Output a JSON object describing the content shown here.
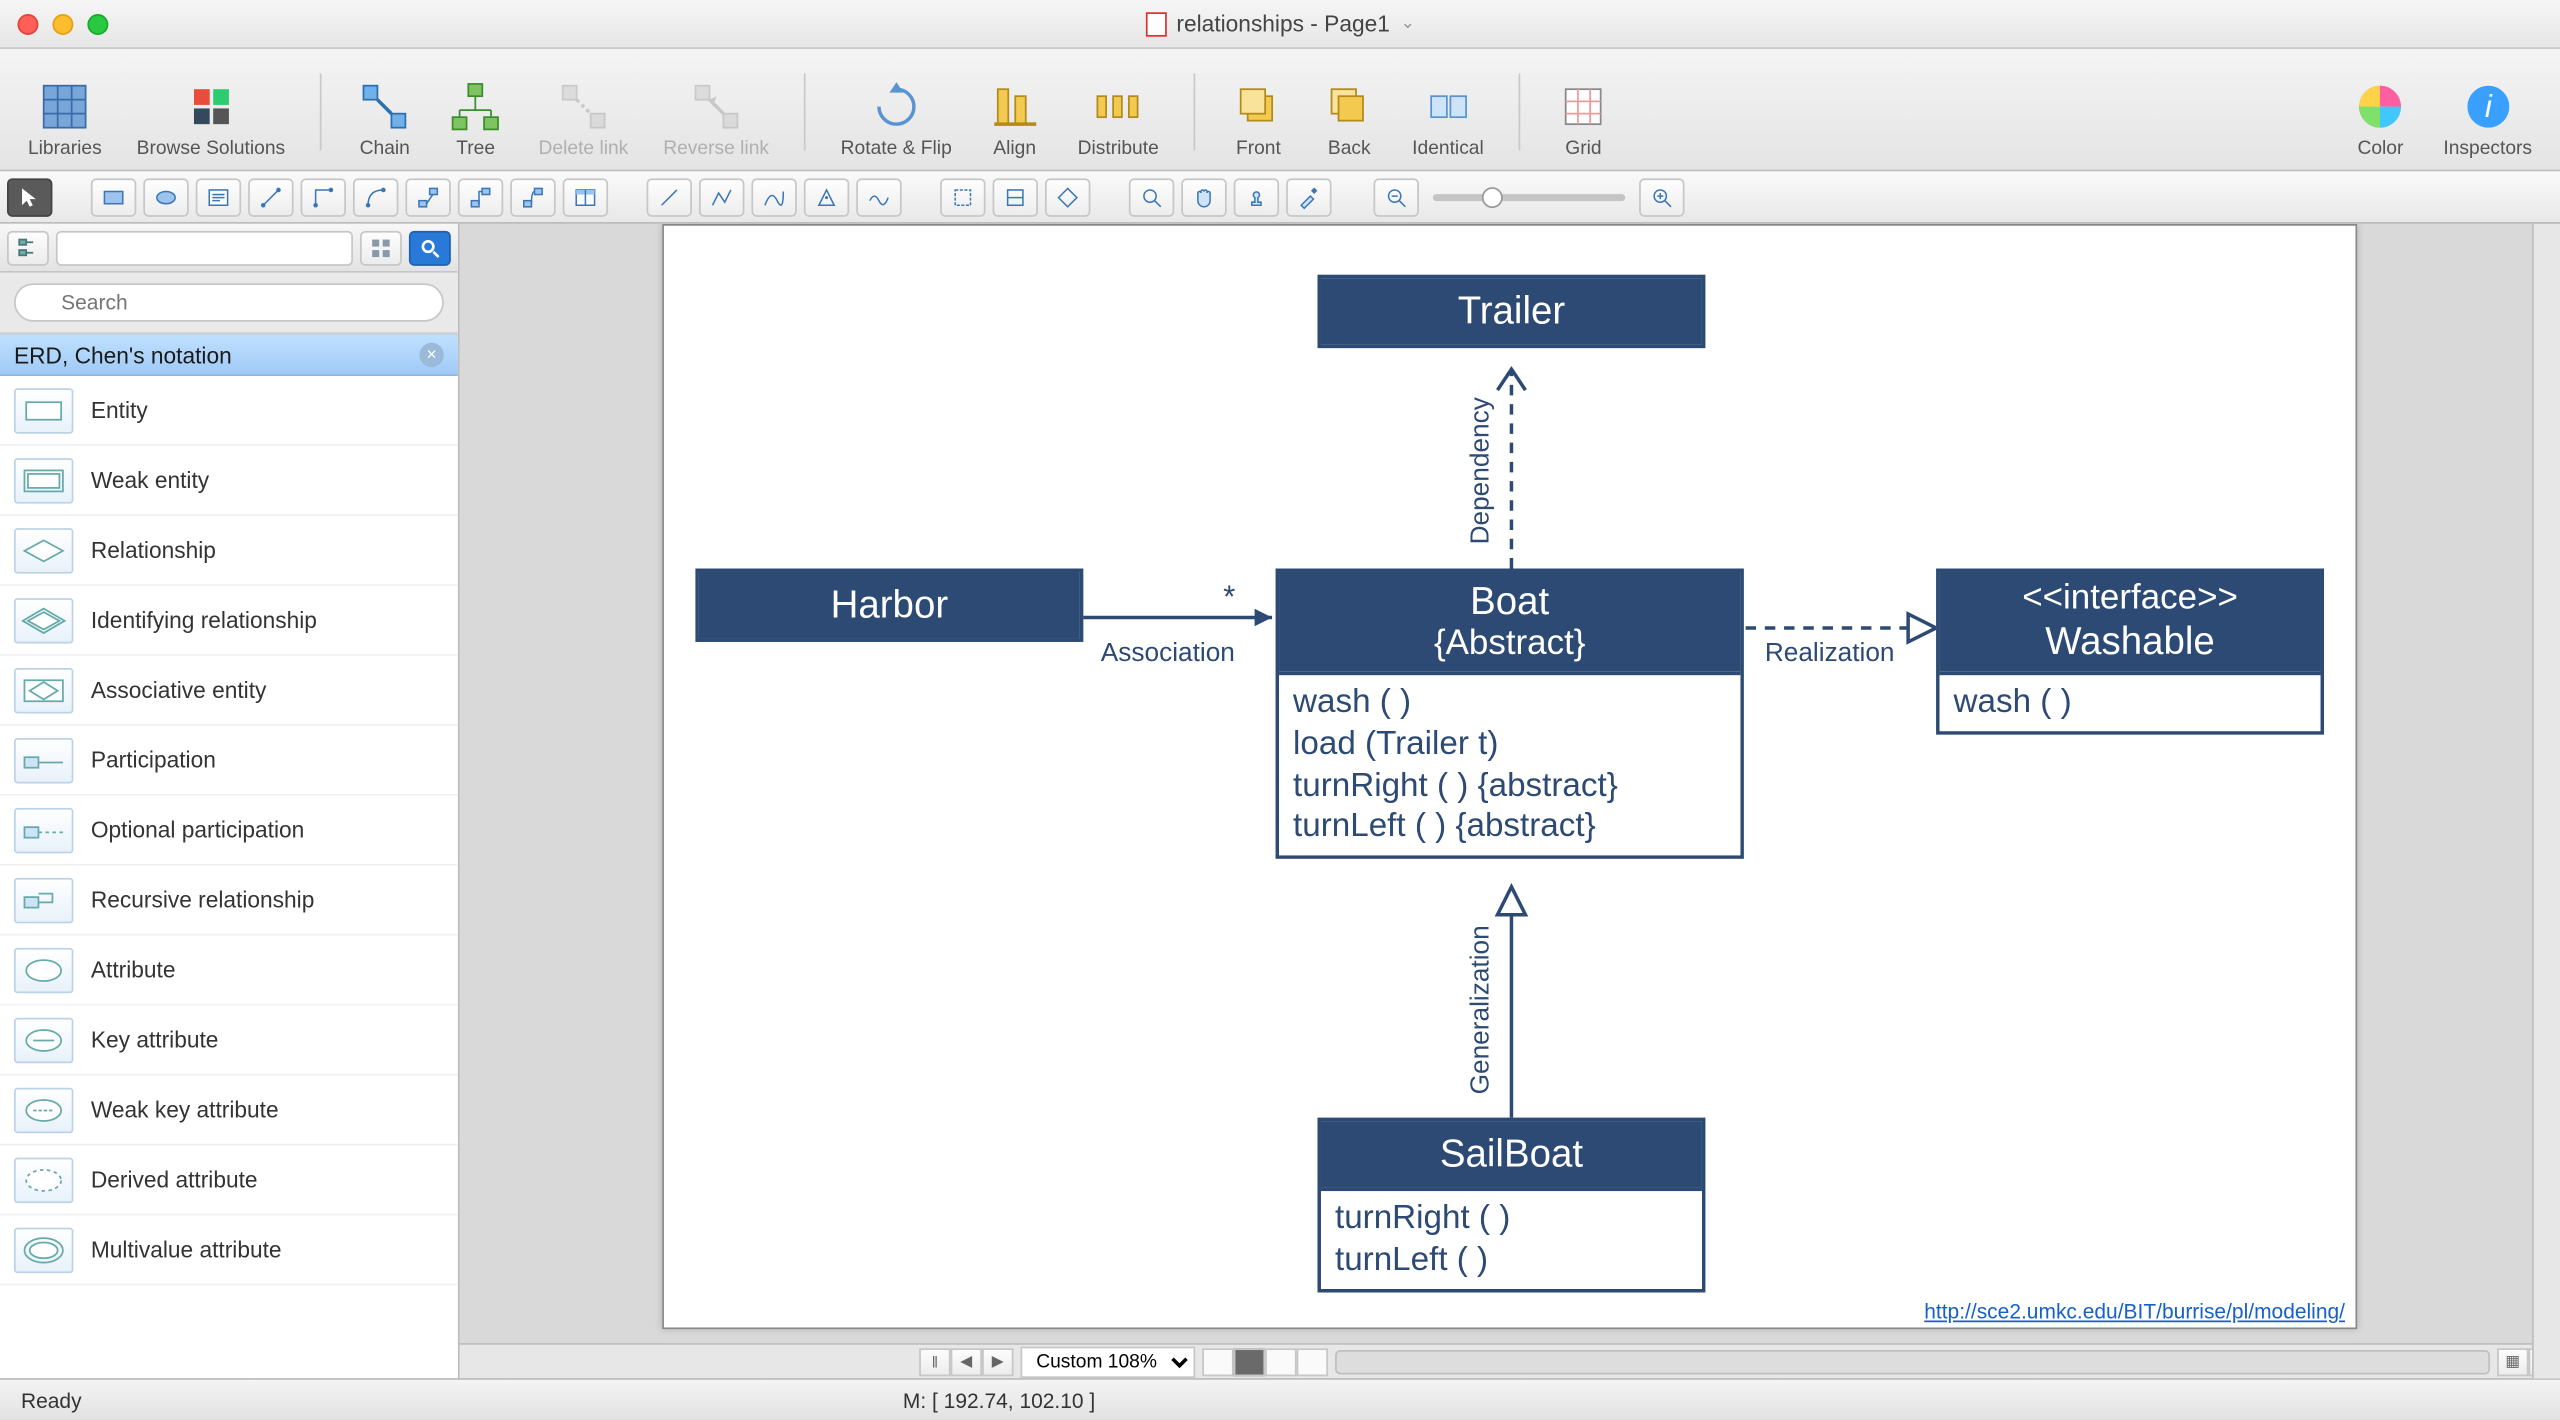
{
  "window": {
    "title": "relationships - Page1"
  },
  "toolbar": {
    "libraries": "Libraries",
    "browse": "Browse Solutions",
    "chain": "Chain",
    "tree": "Tree",
    "delete_link": "Delete link",
    "reverse_link": "Reverse link",
    "rotate_flip": "Rotate & Flip",
    "align": "Align",
    "distribute": "Distribute",
    "front": "Front",
    "back": "Back",
    "identical": "Identical",
    "grid": "Grid",
    "color": "Color",
    "inspectors": "Inspectors"
  },
  "sidebar": {
    "search_placeholder": "Search",
    "library_name": "ERD, Chen's notation",
    "items": [
      {
        "label": "Entity"
      },
      {
        "label": "Weak entity"
      },
      {
        "label": "Relationship"
      },
      {
        "label": "Identifying relationship"
      },
      {
        "label": "Associative entity"
      },
      {
        "label": "Participation"
      },
      {
        "label": "Optional participation"
      },
      {
        "label": "Recursive relationship"
      },
      {
        "label": "Attribute"
      },
      {
        "label": "Key attribute"
      },
      {
        "label": "Weak key attribute"
      },
      {
        "label": "Derived attribute"
      },
      {
        "label": "Multivalue attribute"
      }
    ]
  },
  "diagram": {
    "trailer": {
      "title": "Trailer"
    },
    "harbor": {
      "title": "Harbor"
    },
    "boat": {
      "title": "Boat",
      "subtitle": "{Abstract}",
      "ops": [
        "wash ( )",
        "load (Trailer t)",
        "turnRight ( ) {abstract}",
        "turnLeft ( ) {abstract}"
      ]
    },
    "washable": {
      "title1": "<<interface>>",
      "title2": "Washable",
      "ops": [
        "wash ( )"
      ]
    },
    "sailboat": {
      "title": "SailBoat",
      "ops": [
        "turnRight ( )",
        "turnLeft ( )"
      ]
    },
    "labels": {
      "association": "Association",
      "dependency": "Dependency",
      "realization": "Realization",
      "generalization": "Generalization",
      "star": "*"
    },
    "link": "http://sce2.umkc.edu/BIT/burrise/pl/modeling/"
  },
  "bottom": {
    "zoom": "Custom 108%"
  },
  "status": {
    "ready": "Ready",
    "mouse": "M: [ 192.74, 102.10 ]"
  }
}
